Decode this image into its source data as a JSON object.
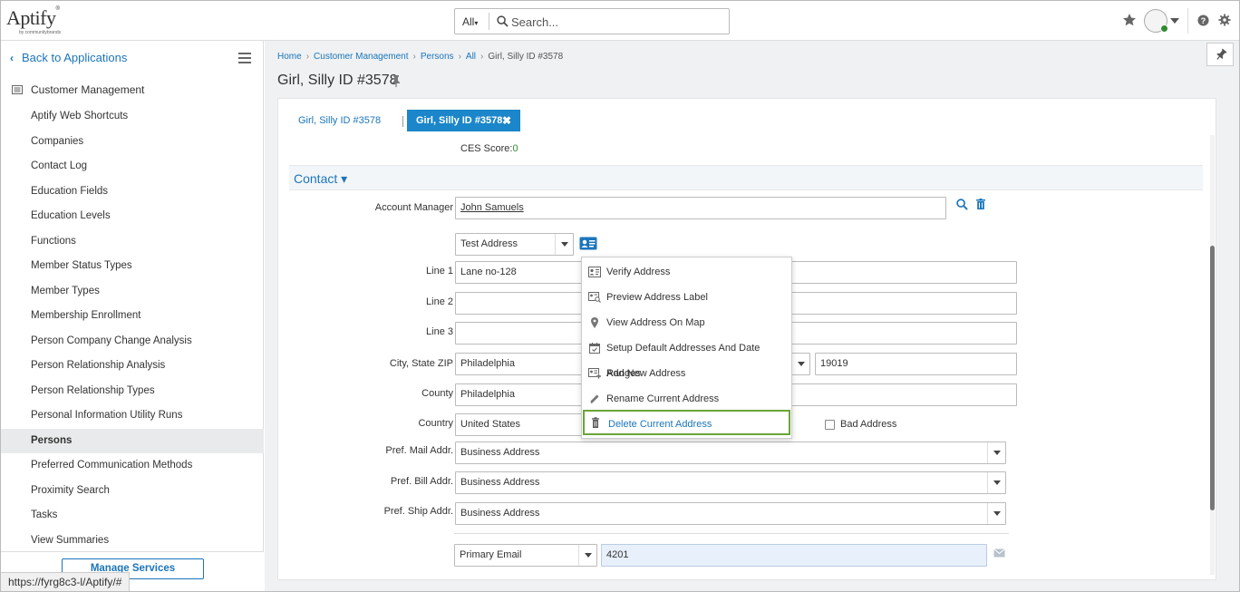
{
  "header": {
    "logo_text": "Aptify",
    "logo_sub": "by communitybrands",
    "search_scope": "All",
    "search_placeholder": "Search..."
  },
  "sidebar": {
    "back_label": "Back to Applications",
    "module_label": "Customer Management",
    "items": [
      {
        "label": "Aptify Web Shortcuts"
      },
      {
        "label": "Companies"
      },
      {
        "label": "Contact Log"
      },
      {
        "label": "Education Fields"
      },
      {
        "label": "Education Levels"
      },
      {
        "label": "Functions"
      },
      {
        "label": "Member Status Types"
      },
      {
        "label": "Member Types"
      },
      {
        "label": "Membership Enrollment"
      },
      {
        "label": "Person Company Change Analysis"
      },
      {
        "label": "Person Relationship Analysis"
      },
      {
        "label": "Person Relationship Types"
      },
      {
        "label": "Personal Information Utility Runs"
      },
      {
        "label": "Persons"
      },
      {
        "label": "Preferred Communication Methods"
      },
      {
        "label": "Proximity Search"
      },
      {
        "label": "Tasks"
      },
      {
        "label": "View Summaries"
      }
    ],
    "active_item": "Persons",
    "manage_services_label": "Manage Services"
  },
  "status_bar_url": "https://fyrg8c3-l/Aptify/#",
  "breadcrumb": {
    "items": [
      "Home",
      "Customer Management",
      "Persons",
      "All"
    ],
    "current": "Girl, Silly ID #3578"
  },
  "page_title": "Girl, Silly ID #3578",
  "tabs": {
    "tab1_label": "Girl, Silly ID #3578",
    "tab2_label": "Girl, Silly ID #3578"
  },
  "ces": {
    "label": "CES Score:",
    "value": "0"
  },
  "section_label": "Contact ▾",
  "form": {
    "account_manager_label": "Account Manager",
    "account_manager_value": "John Samuels",
    "address_type": "Test Address",
    "line1_label": "Line 1",
    "line1_value": "Lane no-128",
    "line2_label": "Line 2",
    "line3_label": "Line 3",
    "city_state_zip_label": "City, State ZIP",
    "city_value": "Philadelphia",
    "zip_value": "19019",
    "county_label": "County",
    "county_value": "Philadelphia",
    "country_label": "Country",
    "country_value": "United States",
    "bad_address_label": "Bad Address",
    "pref_mail_label": "Pref. Mail Addr.",
    "pref_mail_value": "Business Address",
    "pref_bill_label": "Pref. Bill Addr.",
    "pref_bill_value": "Business Address",
    "pref_ship_label": "Pref. Ship Addr.",
    "pref_ship_value": "Business Address",
    "email_type": "Primary Email",
    "email_value": "4201"
  },
  "address_menu": {
    "items": [
      {
        "label": "Verify Address",
        "icon": "address-card-icon"
      },
      {
        "label": "Preview Address Label",
        "icon": "address-search-icon"
      },
      {
        "label": "View Address On Map",
        "icon": "map-pin-icon"
      },
      {
        "label": "Setup Default Addresses And Date Ranges",
        "icon": "calendar-check-icon"
      },
      {
        "label": "Add New Address",
        "icon": "address-add-icon"
      },
      {
        "label": "Rename Current Address",
        "icon": "pencil-icon"
      },
      {
        "label": "Delete Current Address",
        "icon": "trash-icon"
      }
    ]
  },
  "colors": {
    "accent": "#1b75bb",
    "active_tab": "#1b86c9",
    "highlight_border": "#6aa536",
    "ces_value": "#2e8b2e"
  }
}
